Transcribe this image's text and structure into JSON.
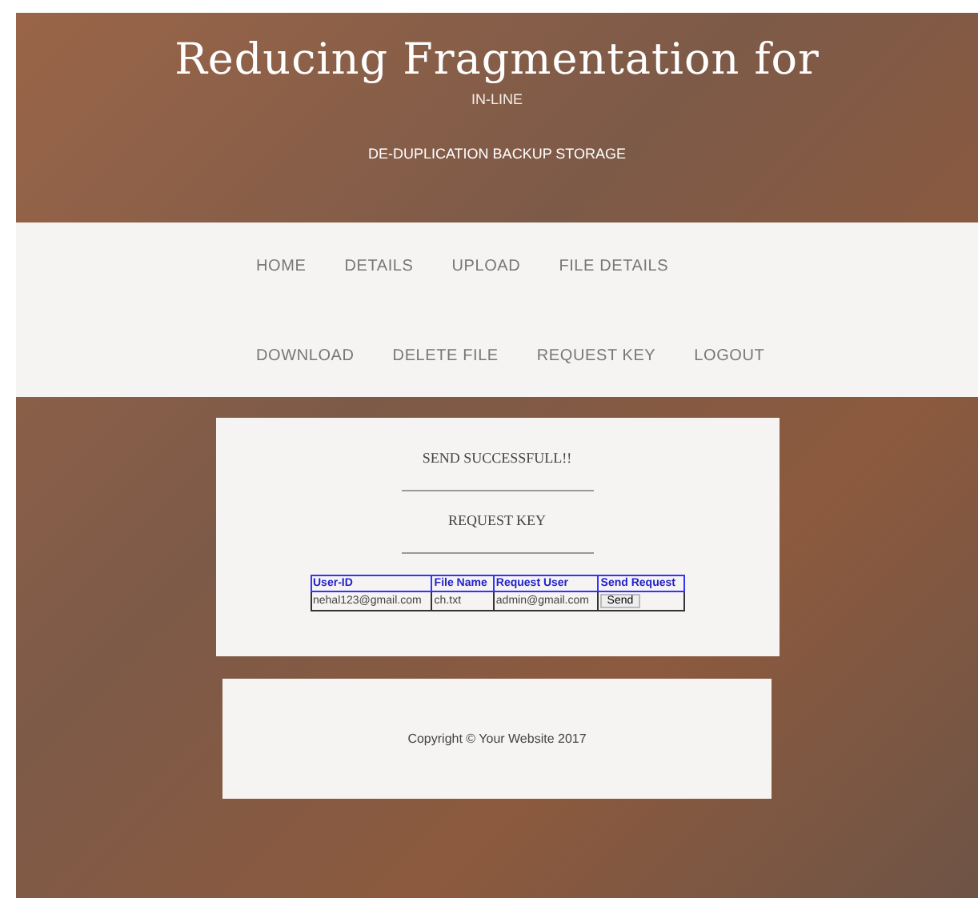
{
  "header": {
    "title": "Reducing Fragmentation for",
    "subtitle": "IN-LINE",
    "tagline": "DE-DUPLICATION BACKUP STORAGE"
  },
  "nav": {
    "items": [
      {
        "label": "HOME"
      },
      {
        "label": "DETAILS"
      },
      {
        "label": "UPLOAD"
      },
      {
        "label": "FILE DETAILS"
      },
      {
        "label": "DOWNLOAD"
      },
      {
        "label": "DELETE FILE"
      },
      {
        "label": "REQUEST KEY"
      },
      {
        "label": "LOGOUT"
      }
    ]
  },
  "content": {
    "message": "SEND SUCCESSFULL!!",
    "heading": "REQUEST KEY",
    "table": {
      "columns": [
        "User-ID",
        "File Name",
        "Request User",
        "Send Request"
      ],
      "rows": [
        {
          "user_id": "nehal123@gmail.com",
          "file_name": "ch.txt",
          "request_user": "admin@gmail.com",
          "action": "Send"
        }
      ]
    }
  },
  "footer": {
    "text": "Copyright © Your Website 2017"
  }
}
